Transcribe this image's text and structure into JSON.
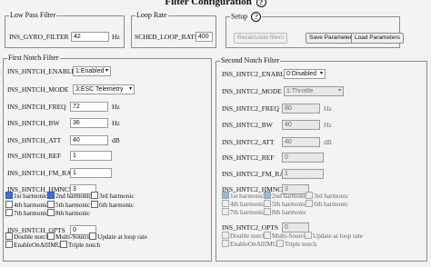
{
  "title": "Filter Configuration",
  "help_glyph": "?",
  "low_pass": {
    "legend": "Low Pass Filter",
    "label": "INS_GYRO_FILTER",
    "value": "42",
    "unit": "Hz"
  },
  "loop_rate": {
    "legend": "Loop Rate",
    "label": "SCHED_LOOP_RATE",
    "value": "400"
  },
  "setup": {
    "legend": "Setup",
    "buttons": [
      "Recalculate filters",
      "Save Parameters",
      "Load Parameters"
    ]
  },
  "first": {
    "legend": "First Notch Filter",
    "enable_label": "INS_HNTCH_ENABLE",
    "enable_value": "1:Enabled",
    "mode_label": "INS_HNTCH_MODE",
    "mode_value": "3:ESC Telemetry",
    "freq_label": "INS_HNTCH_FREQ",
    "freq_value": "72",
    "freq_unit": "Hz",
    "bw_label": "INS_HNTCH_BW",
    "bw_value": "36",
    "bw_unit": "Hz",
    "att_label": "INS_HNTCH_ATT",
    "att_value": "40",
    "att_unit": "dB",
    "ref_label": "INS_HNTCH_REF",
    "ref_value": "1",
    "fmrat_label": "INS_HNTCH_FM_RAT",
    "fmrat_value": "1",
    "hmncs_label": "INS_HNTCH_HMNCS",
    "hmncs_value": "3",
    "harmonics": [
      {
        "label": "1st harmonic",
        "checked": true
      },
      {
        "label": "2nd harmonic",
        "checked": true
      },
      {
        "label": "3rd harmonic",
        "checked": false
      },
      {
        "label": "4th harmonic",
        "checked": false
      },
      {
        "label": "5th harmonic",
        "checked": false
      },
      {
        "label": "6th harmonic",
        "checked": false
      },
      {
        "label": "7th harmonic",
        "checked": false
      },
      {
        "label": "8th harmonic",
        "checked": false
      }
    ],
    "opts_label": "INS_HNTCH_OPTS",
    "opts_value": "0",
    "options": [
      {
        "label": "Double notch",
        "checked": false
      },
      {
        "label": "Multi-Source",
        "checked": false
      },
      {
        "label": "Update at loop rate",
        "checked": false
      },
      {
        "label": "EnableOnAllIMUs",
        "checked": false
      },
      {
        "label": "Triple notch",
        "checked": false
      }
    ]
  },
  "second": {
    "legend": "Second Notch Filter",
    "enable_label": "INS_HNTC2_ENABLE",
    "enable_value": "0:Disabled",
    "mode_label": "INS_HNTC2_MODE",
    "mode_value": "1:Throttle",
    "freq_label": "INS_HNTC2_FREQ",
    "freq_value": "80",
    "freq_unit": "Hz",
    "bw_label": "INS_HNTC2_BW",
    "bw_value": "40",
    "bw_unit": "Hz",
    "att_label": "INS_HNTC2_ATT",
    "att_value": "40",
    "att_unit": "dB",
    "ref_label": "INS_HNTC2_REF",
    "ref_value": "0",
    "fmrat_label": "INS_HNTC2_FM_RAT",
    "fmrat_value": "1",
    "hmncs_label": "INS_HNTC2_HMNCS",
    "hmncs_value": "3",
    "harmonics": [
      {
        "label": "1st harmonic",
        "checked": true
      },
      {
        "label": "2nd harmonic",
        "checked": true
      },
      {
        "label": "3rd harmonic",
        "checked": false
      },
      {
        "label": "4th harmonic",
        "checked": false
      },
      {
        "label": "5th harmonic",
        "checked": false
      },
      {
        "label": "6th harmonic",
        "checked": false
      },
      {
        "label": "7th harmonic",
        "checked": false
      },
      {
        "label": "8th harmonic",
        "checked": false
      }
    ],
    "opts_label": "INS_HNTC2_OPTS",
    "opts_value": "0",
    "options": [
      {
        "label": "Double notch",
        "checked": false
      },
      {
        "label": "Multi-Source",
        "checked": false
      },
      {
        "label": "Update at loop rate",
        "checked": false
      },
      {
        "label": "EnableOnAllIMUs",
        "checked": false
      },
      {
        "label": "Triple notch",
        "checked": false
      }
    ]
  }
}
